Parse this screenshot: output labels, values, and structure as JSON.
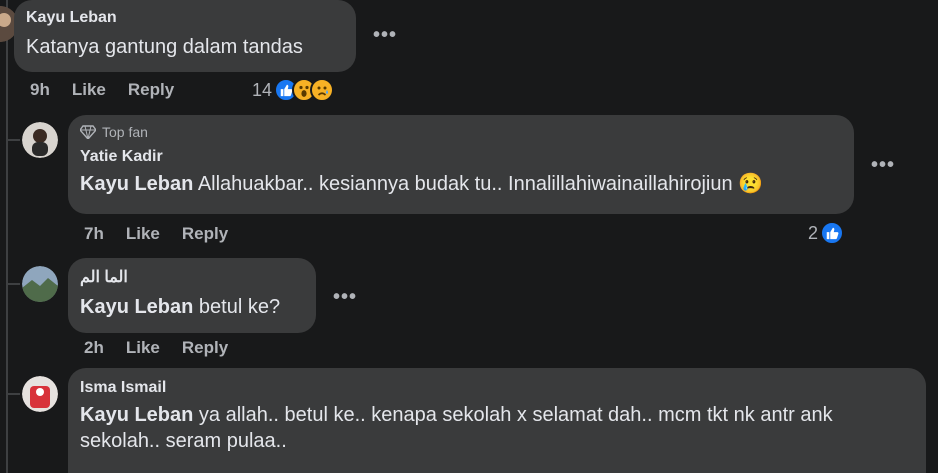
{
  "comments": [
    {
      "author": "Kayu Leban",
      "text": "Katanya gantung dalam tandas",
      "time": "9h",
      "like": "Like",
      "reply": "Reply",
      "reactions_count": "14",
      "reactions": [
        "like-icon",
        "wow-icon",
        "sad-icon"
      ]
    },
    {
      "badge": "Top fan",
      "author": "Yatie Kadir",
      "mention": "Kayu Leban",
      "text": "Allahuakbar.. kesiannya budak tu.. Innalillahiwainaillahirojiun 😢",
      "time": "7h",
      "like": "Like",
      "reply": "Reply",
      "reactions_count": "2",
      "reactions": [
        "like-icon"
      ]
    },
    {
      "author": "الما الم",
      "mention": "Kayu Leban",
      "text": "betul ke?",
      "time": "2h",
      "like": "Like",
      "reply": "Reply"
    },
    {
      "author": "Isma Ismail",
      "mention": "Kayu Leban",
      "text_line1": "ya allah.. betul ke.. kenapa sekolah x selamat dah.. mcm tkt nk antr ank",
      "text_line2": "sekolah.. seram pulaa.."
    }
  ],
  "colors": {
    "background": "#18191a",
    "bubble": "#3a3b3c",
    "like_blue": "#1877f2",
    "wow_yellow": "#f7b125"
  }
}
